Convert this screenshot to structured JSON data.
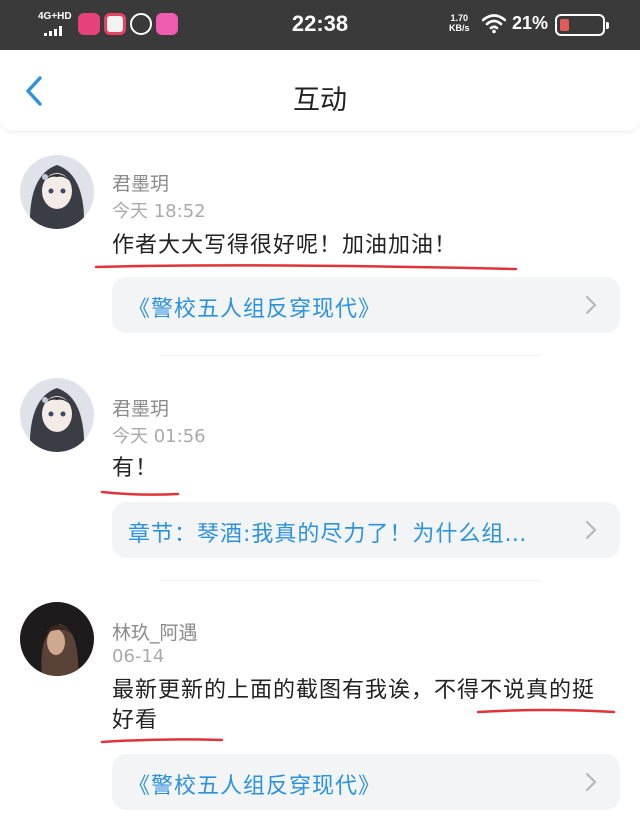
{
  "status_bar": {
    "network": "4G+HD",
    "time": "22:38",
    "speed_value": "1.70",
    "speed_unit": "KB/s",
    "battery": "21%"
  },
  "nav": {
    "title": "互动",
    "back_icon": "chevron-left-icon"
  },
  "colors": {
    "accent": "#2b92e0",
    "underline": "#e0343a",
    "card_bg": "#f3f4f6",
    "status_bg": "#3a3a3a"
  },
  "comments": [
    {
      "username": "君墨玥",
      "time": "今天 18:52",
      "content": "作者大大写得很好呢！加油加油！",
      "reference": "《警校五人组反穿现代》"
    },
    {
      "username": "君墨玥",
      "time": "今天 01:56",
      "content": "有！",
      "reference": "章节：琴酒:我真的尽力了！为什么组…"
    },
    {
      "username": "林玖_阿遇",
      "time": "06-14",
      "content": "最新更新的上面的截图有我诶，不得不说真的挺好看",
      "reference": "《警校五人组反穿现代》"
    }
  ]
}
